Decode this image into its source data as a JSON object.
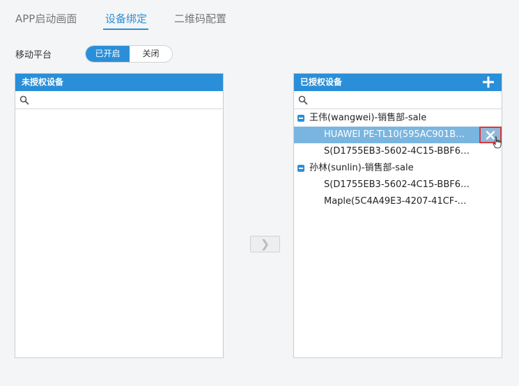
{
  "tabs": [
    {
      "label": "APP启动画面"
    },
    {
      "label": "设备绑定"
    },
    {
      "label": "二维码配置"
    }
  ],
  "platform": {
    "label": "移动平台",
    "on_label": "已开启",
    "off_label": "关闭"
  },
  "unauthorized": {
    "title": "未授权设备",
    "search_placeholder": ""
  },
  "authorized": {
    "title": "已授权设备",
    "search_placeholder": "",
    "groups": [
      {
        "label": "王伟(wangwei)-销售部-sale",
        "devices": [
          {
            "label": "HUAWEI PE-TL10(595AC901B7B6..."
          },
          {
            "label": "S(D1755EB3-5602-4C15-BBF6-97..."
          }
        ]
      },
      {
        "label": "孙林(sunlin)-销售部-sale",
        "devices": [
          {
            "label": "S(D1755EB3-5602-4C15-BBF6-97..."
          },
          {
            "label": "Maple(5C4A49E3-4207-41CF-B28..."
          }
        ]
      }
    ]
  },
  "transfer_glyph": "❯"
}
